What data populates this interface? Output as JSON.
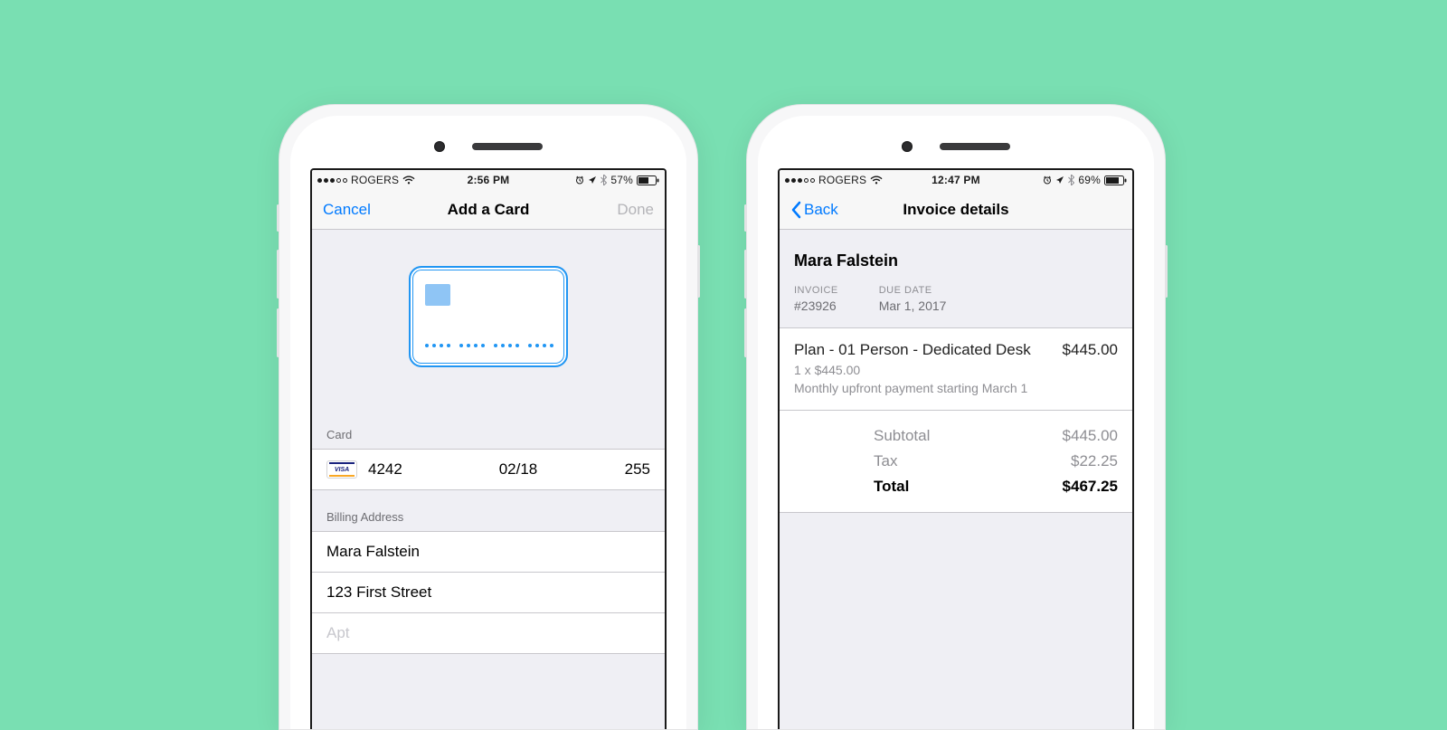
{
  "left": {
    "status": {
      "carrier": "ROGERS",
      "time": "2:56 PM",
      "battery": "57%"
    },
    "nav": {
      "cancel": "Cancel",
      "title": "Add a Card",
      "done": "Done"
    },
    "card_section_label": "Card",
    "card": {
      "last4": "4242",
      "expiry": "02/18",
      "cvc": "255"
    },
    "billing_section_label": "Billing Address",
    "billing": {
      "name": "Mara Falstein",
      "street": "123 First Street",
      "apt": "Apt"
    }
  },
  "right": {
    "status": {
      "carrier": "ROGERS",
      "time": "12:47 PM",
      "battery": "69%"
    },
    "nav": {
      "back": "Back",
      "title": "Invoice details"
    },
    "invoice": {
      "customer": "Mara Falstein",
      "invoice_label": "INVOICE",
      "invoice_number": "#23926",
      "due_label": "DUE DATE",
      "due_date": "Mar 1, 2017"
    },
    "line": {
      "title": "Plan - 01 Person - Dedicated Desk",
      "amount": "$445.00",
      "qty": "1 x $445.00",
      "desc": "Monthly upfront payment starting March 1"
    },
    "totals": {
      "subtotal_label": "Subtotal",
      "subtotal": "$445.00",
      "tax_label": "Tax",
      "tax": "$22.25",
      "total_label": "Total",
      "total": "$467.25"
    }
  }
}
